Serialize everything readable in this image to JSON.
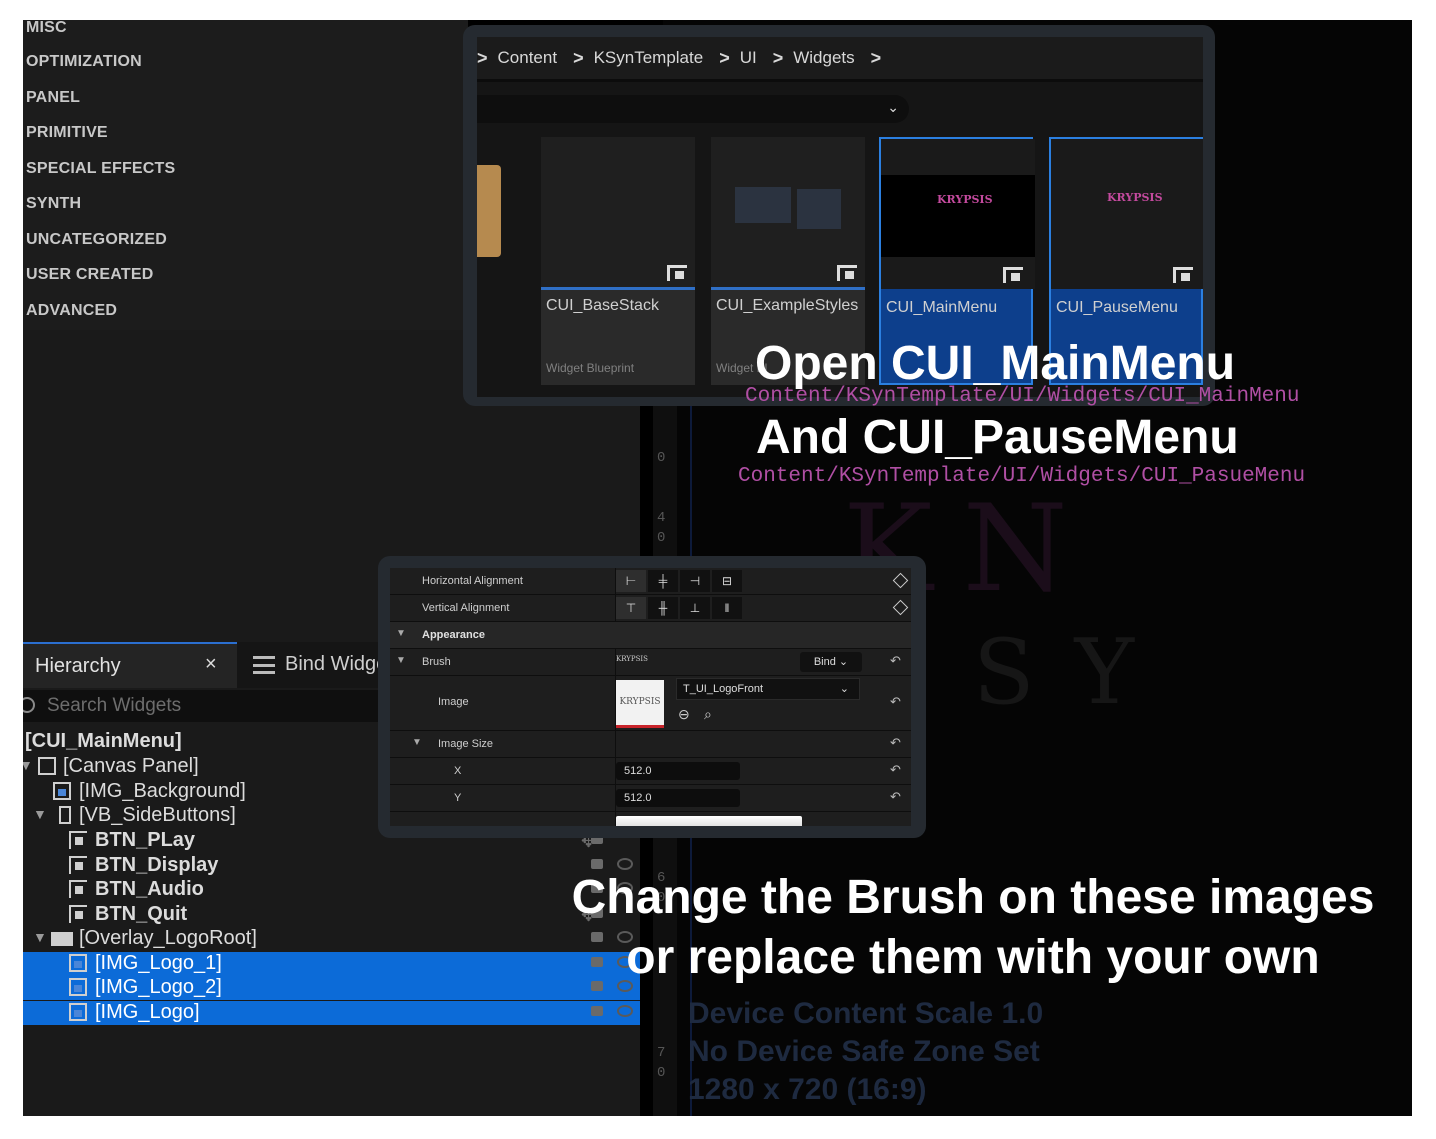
{
  "palette": {
    "categories": [
      "MISC",
      "OPTIMIZATION",
      "PANEL",
      "PRIMITIVE",
      "SPECIAL EFFECTS",
      "SYNTH",
      "UNCATEGORIZED",
      "USER CREATED",
      "ADVANCED"
    ]
  },
  "content_browser": {
    "breadcrumb": [
      "Content",
      "KSynTemplate",
      "UI",
      "Widgets"
    ],
    "assets": [
      {
        "name": "CUI_BaseStack",
        "type": "Widget Blueprint"
      },
      {
        "name": "CUI_ExampleStyles",
        "type": "Widget Bl"
      },
      {
        "name": "CUI_MainMenu",
        "type": ""
      },
      {
        "name": "CUI_PauseMenu",
        "type": ""
      }
    ],
    "thumb_logo": "KRYPSIS"
  },
  "hierarchy": {
    "tab_label": "Hierarchy",
    "close_glyph": "×",
    "bind_tab_label": "Bind Widge",
    "search_placeholder": "Search Widgets",
    "rows": [
      "[CUI_MainMenu]",
      "[Canvas Panel]",
      "[IMG_Background]",
      "[VB_SideButtons]",
      "BTN_PLay",
      "BTN_Display",
      "BTN_Audio",
      "BTN_Quit",
      "[Overlay_LogoRoot]",
      "[IMG_Logo_1]",
      "[IMG_Logo_2]",
      "[IMG_Logo]"
    ]
  },
  "details": {
    "horizontal_alignment": "Horizontal Alignment",
    "vertical_alignment": "Vertical Alignment",
    "appearance": "Appearance",
    "brush": "Brush",
    "bind": "Bind",
    "image": "Image",
    "image_asset": "T_UI_LogoFront",
    "image_preview_text": "KRYPSIS",
    "image_size": "Image Size",
    "x_label": "X",
    "x_value": "512.0",
    "y_label": "Y",
    "y_value": "512.0"
  },
  "overlay": {
    "line1": "Open CUI_MainMenu",
    "path1": "Content/KSynTemplate/UI/Widgets/CUI_MainMenu",
    "line2": "And CUI_PauseMenu",
    "path2": "Content/KSynTemplate/UI/Widgets/CUI_PasueMenu",
    "instruction1": "Change the Brush on these images",
    "instruction2": "or replace them with your own"
  },
  "canvas": {
    "device_line1": "Device Content Scale 1.0",
    "device_line2": "No Device Safe Zone Set",
    "device_line3": "1280 x 720 (16:9)"
  },
  "colors": {
    "accent_blue": "#0c6bd8",
    "path_magenta": "#b04fa4",
    "panel_frame": "#252a30"
  }
}
